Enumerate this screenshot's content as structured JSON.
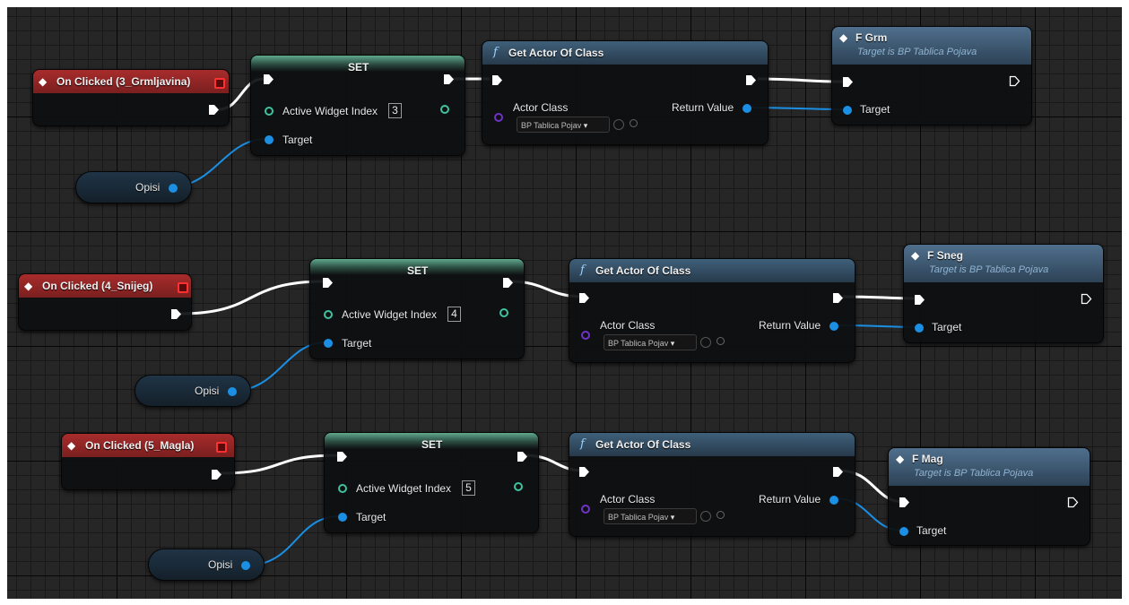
{
  "colors": {
    "exec_wire": "#ffffff",
    "object_wire": "#1a8fe3",
    "event_header": "#a82c2c",
    "function_header": "#3f607a",
    "set_header": "#5fa88c"
  },
  "rows": [
    {
      "event": {
        "label": "On Clicked (3_Grmljavina)"
      },
      "set": {
        "title": "SET",
        "pin": "Active Widget Index",
        "value": "3",
        "target": "Target"
      },
      "var": {
        "label": "Opisi"
      },
      "get": {
        "title": "Get Actor Of Class",
        "class_label": "Actor Class",
        "class_value": "BP Tablica Pojav",
        "return": "Return Value"
      },
      "call": {
        "title": "F Grm",
        "subtitle": "Target is BP Tablica Pojava",
        "target": "Target"
      }
    },
    {
      "event": {
        "label": "On Clicked (4_Snijeg)"
      },
      "set": {
        "title": "SET",
        "pin": "Active Widget Index",
        "value": "4",
        "target": "Target"
      },
      "var": {
        "label": "Opisi"
      },
      "get": {
        "title": "Get Actor Of Class",
        "class_label": "Actor Class",
        "class_value": "BP Tablica Pojav",
        "return": "Return Value"
      },
      "call": {
        "title": "F Sneg",
        "subtitle": "Target is BP Tablica Pojava",
        "target": "Target"
      }
    },
    {
      "event": {
        "label": "On Clicked (5_Magla)"
      },
      "set": {
        "title": "SET",
        "pin": "Active Widget Index",
        "value": "5",
        "target": "Target"
      },
      "var": {
        "label": "Opisi"
      },
      "get": {
        "title": "Get Actor Of Class",
        "class_label": "Actor Class",
        "class_value": "BP Tablica Pojav",
        "return": "Return Value"
      },
      "call": {
        "title": "F Mag",
        "subtitle": "Target is BP Tablica Pojava",
        "target": "Target"
      }
    }
  ],
  "icons": {
    "event": "event-diamond-icon",
    "function": "function-f-icon",
    "call": "call-diamond-icon",
    "exec": "exec-arrow-icon",
    "exec_out_hollow": "exec-hollow-icon",
    "dropdown": "chevron-down-icon",
    "browse": "browse-icon",
    "search": "search-icon"
  }
}
